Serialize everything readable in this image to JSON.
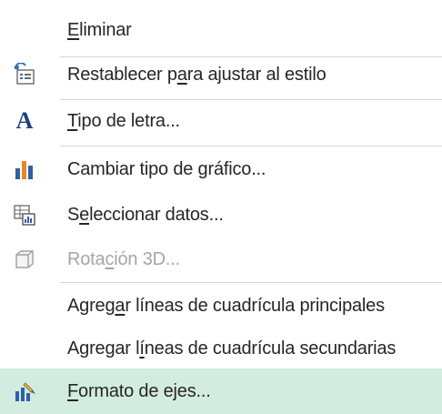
{
  "menu": {
    "items": [
      {
        "id": "delete",
        "icon": "none",
        "pre": "",
        "acc": "E",
        "post": "liminar",
        "disabled": false,
        "highlighted": false
      },
      {
        "id": "reset-style",
        "icon": "reset-style-icon",
        "pre": "Restablecer p",
        "acc": "a",
        "post": "ra ajustar al estilo",
        "disabled": false,
        "highlighted": false
      },
      {
        "id": "font",
        "icon": "font-icon",
        "pre": "",
        "acc": "T",
        "post": "ipo de letra...",
        "disabled": false,
        "highlighted": false
      },
      {
        "id": "change-chart-type",
        "icon": "chart-type-icon",
        "pre": "Cambiar tipo de ",
        "acc": "g",
        "post": "ráfico...",
        "disabled": false,
        "highlighted": false
      },
      {
        "id": "select-data",
        "icon": "select-data-icon",
        "pre": "S",
        "acc": "e",
        "post": "leccionar datos...",
        "disabled": false,
        "highlighted": false
      },
      {
        "id": "3d-rotation",
        "icon": "3d-rotation-icon",
        "pre": "Rota",
        "acc": "c",
        "post": "ión 3D...",
        "disabled": true,
        "highlighted": false
      },
      {
        "id": "add-major-gridlines",
        "icon": "none",
        "pre": "Agreg",
        "acc": "a",
        "post": "r líneas de cuadrícula principales",
        "disabled": false,
        "highlighted": false
      },
      {
        "id": "add-minor-gridlines",
        "icon": "none",
        "pre": "Agregar l",
        "acc": "í",
        "post": "neas de cuadrícula secundarias",
        "disabled": false,
        "highlighted": false
      },
      {
        "id": "format-axis",
        "icon": "format-axis-icon",
        "pre": "",
        "acc": "F",
        "post": "ormato de ejes...",
        "disabled": false,
        "highlighted": true
      }
    ],
    "font_icon_glyph": "A",
    "highlight_color": "#d3ece0"
  }
}
